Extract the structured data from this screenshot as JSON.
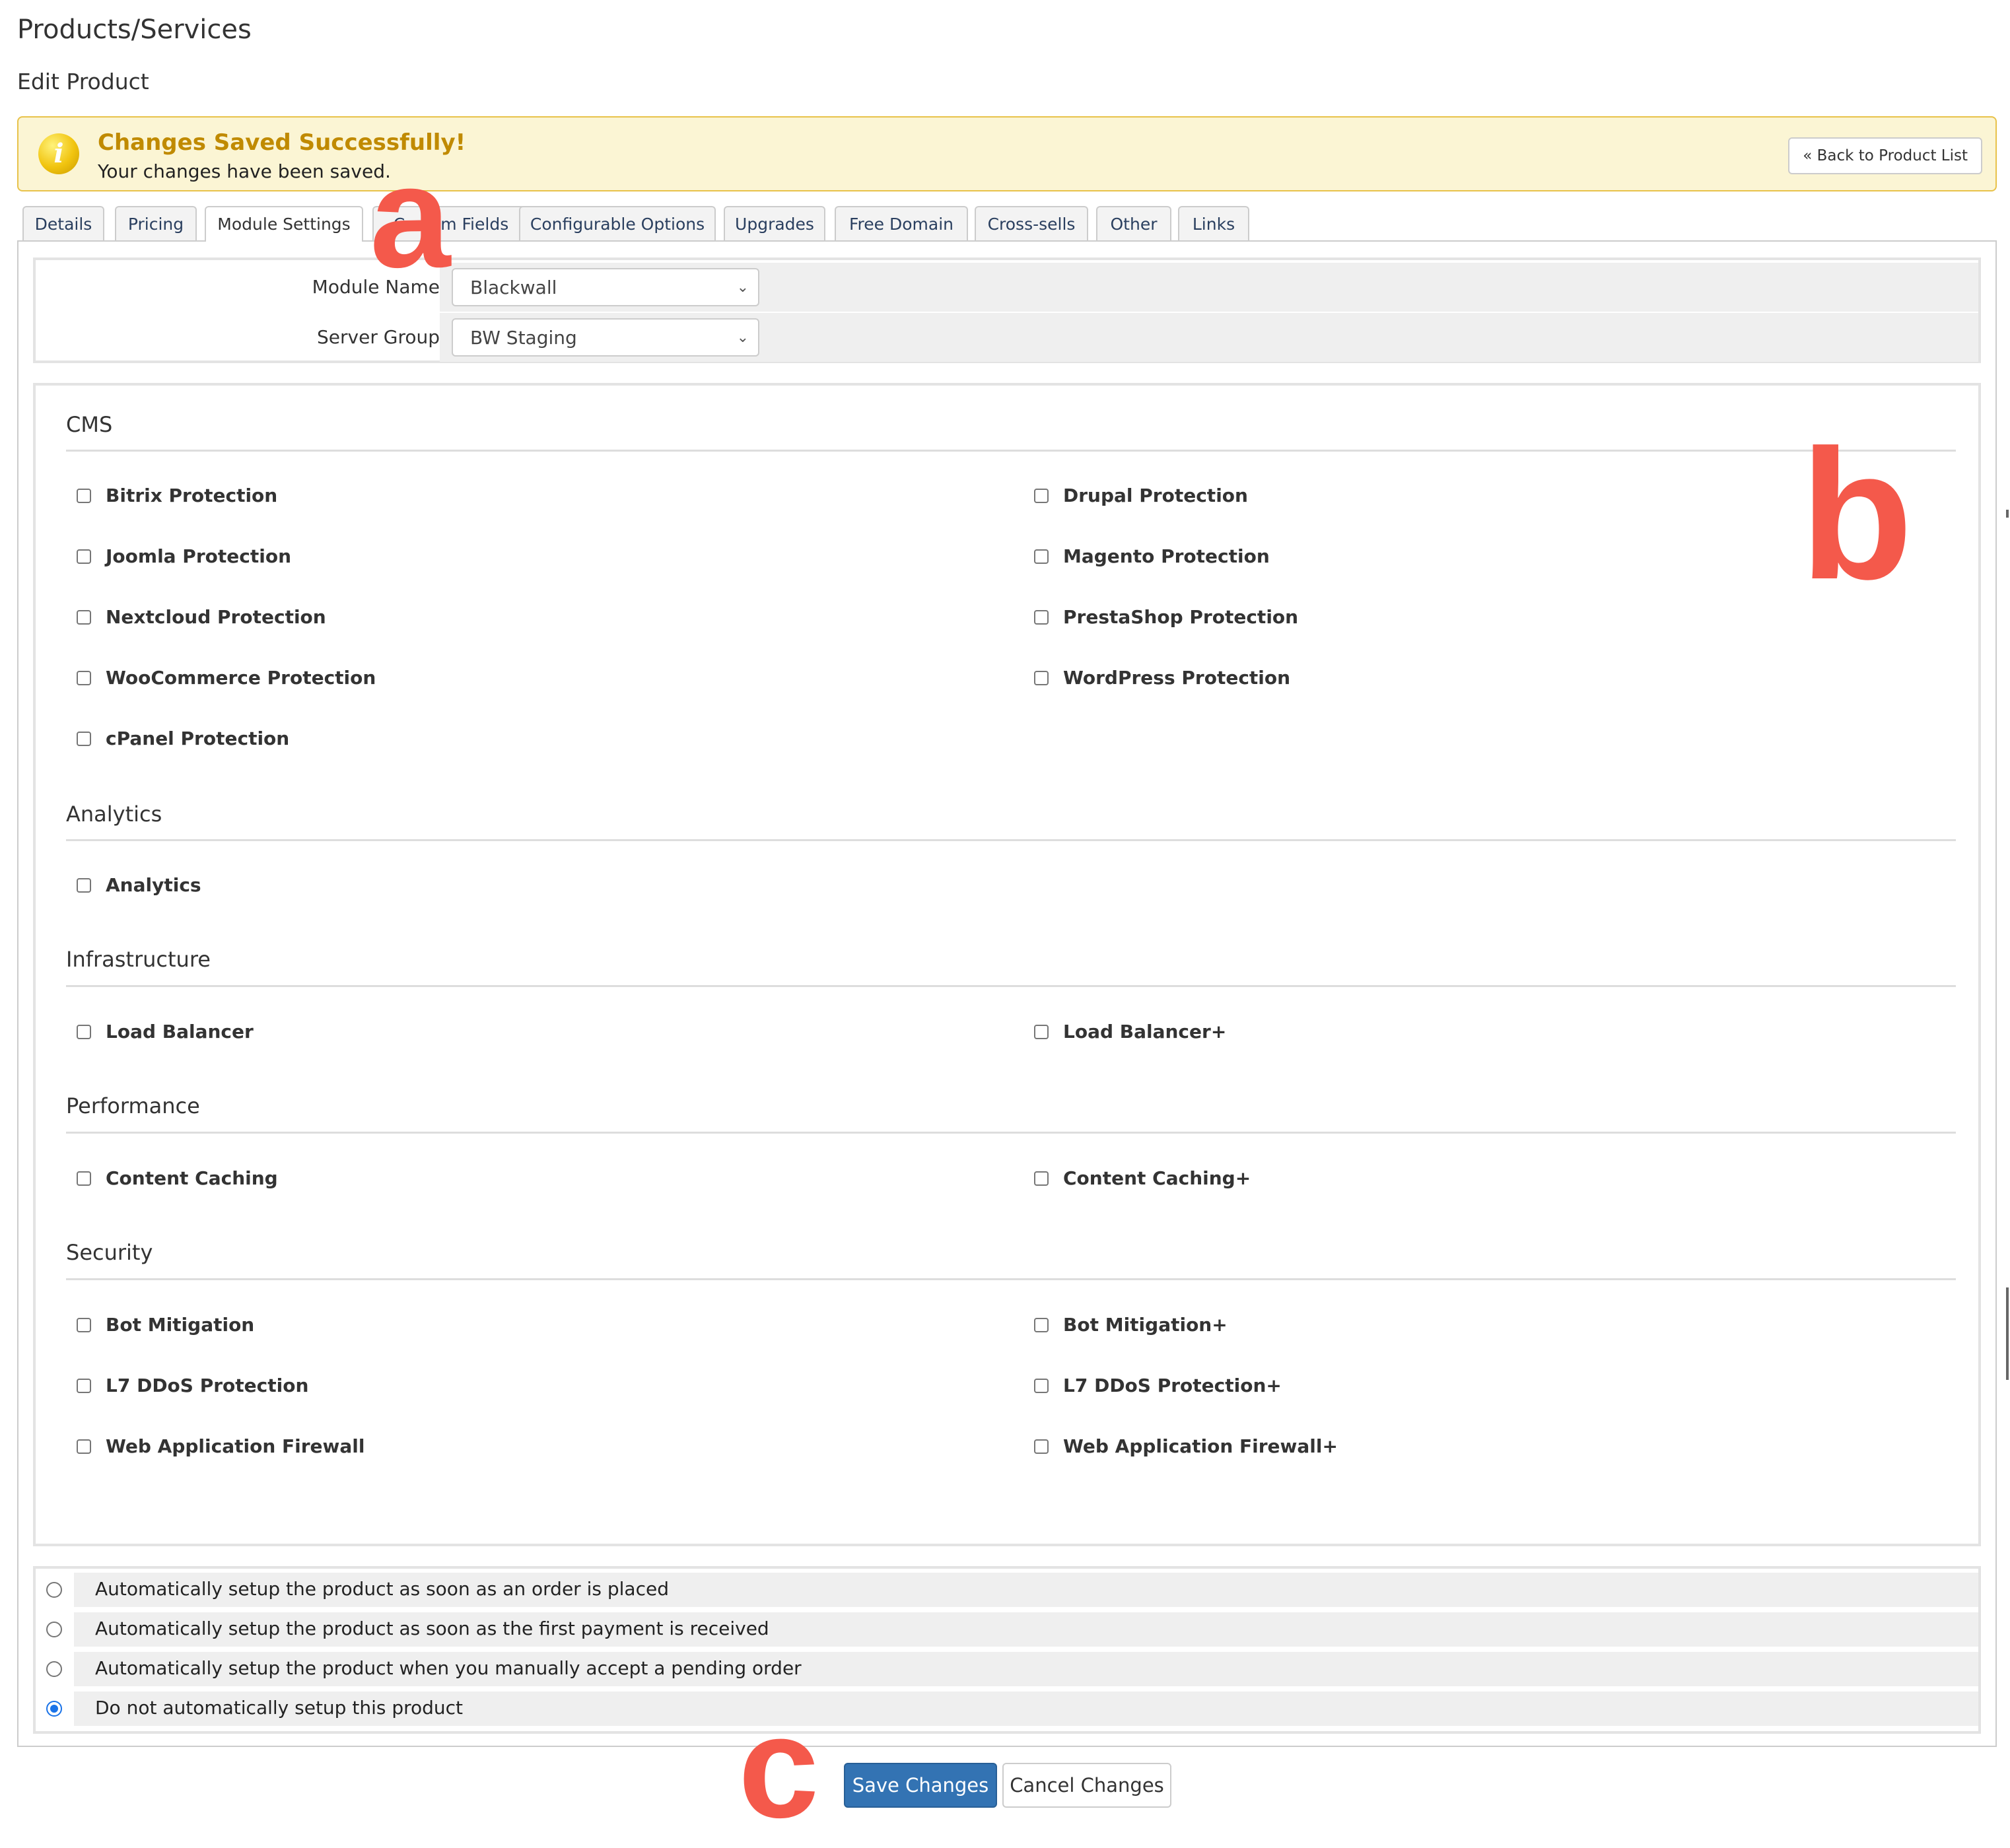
{
  "header": {
    "title": "Products/Services",
    "subtitle": "Edit Product"
  },
  "alert": {
    "title": "Changes Saved Successfully!",
    "message": "Your changes have been saved.",
    "icon": "info-icon",
    "back_button": "« Back to Product List",
    "accent_color": "#c08a00",
    "background_color": "#fbf5d4"
  },
  "tabs": [
    {
      "label": "Details"
    },
    {
      "label": "Pricing"
    },
    {
      "label": "Module Settings",
      "active": true
    },
    {
      "label": "Custom Fields"
    },
    {
      "label": "Configurable Options"
    },
    {
      "label": "Upgrades"
    },
    {
      "label": "Free Domain"
    },
    {
      "label": "Cross-sells"
    },
    {
      "label": "Other"
    },
    {
      "label": "Links"
    }
  ],
  "module": {
    "module_name_label": "Module Name",
    "module_name_value": "Blackwall",
    "server_group_label": "Server Group",
    "server_group_value": "BW Staging"
  },
  "sections": [
    {
      "title": "CMS",
      "options": [
        "Bitrix Protection",
        "Drupal Protection",
        "Joomla Protection",
        "Magento Protection",
        "Nextcloud Protection",
        "PrestaShop Protection",
        "WooCommerce Protection",
        "WordPress Protection",
        "cPanel Protection"
      ]
    },
    {
      "title": "Analytics",
      "options": [
        "Analytics"
      ]
    },
    {
      "title": "Infrastructure",
      "options": [
        "Load Balancer",
        "Load Balancer+"
      ]
    },
    {
      "title": "Performance",
      "options": [
        "Content Caching",
        "Content Caching+"
      ]
    },
    {
      "title": "Security",
      "options": [
        "Bot Mitigation",
        "Bot Mitigation+",
        "L7 DDoS Protection",
        "L7 DDoS Protection+",
        "Web Application Firewall",
        "Web Application Firewall+"
      ]
    }
  ],
  "setup_options": [
    {
      "label": "Automatically setup the product as soon as an order is placed",
      "checked": false
    },
    {
      "label": "Automatically setup the product as soon as the first payment is received",
      "checked": false
    },
    {
      "label": "Automatically setup the product when you manually accept a pending order",
      "checked": false
    },
    {
      "label": "Do not automatically setup this product",
      "checked": true
    }
  ],
  "actions": {
    "save": "Save Changes",
    "cancel": "Cancel Changes",
    "save_color": "#3373b3"
  },
  "markers": {
    "a": "a",
    "b": "b",
    "c": "c",
    "color": "#f4594b"
  }
}
